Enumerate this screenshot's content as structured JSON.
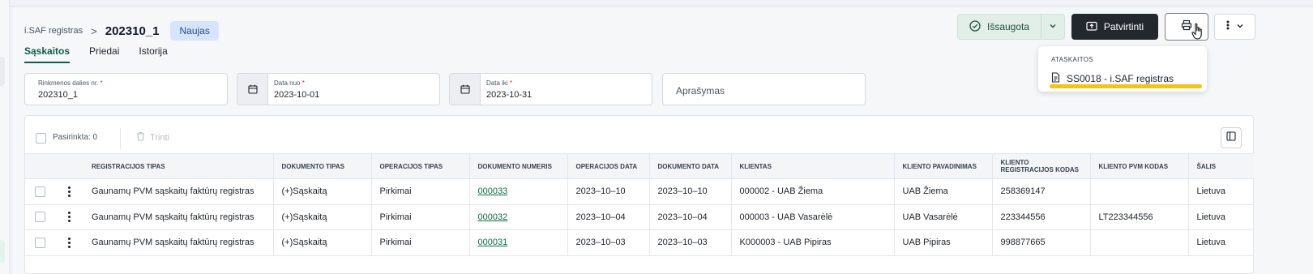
{
  "breadcrumb": {
    "parent": "i.SAF registras",
    "separator": ">",
    "title": "202310_1",
    "status_badge": "Naujas"
  },
  "tabs": [
    {
      "label": "Sąskaitos",
      "active": true
    },
    {
      "label": "Priedai",
      "active": false
    },
    {
      "label": "Istorija",
      "active": false
    }
  ],
  "actions": {
    "saved_label": "Išsaugota",
    "confirm_label": "Patvirtinti",
    "print_icon": "printer-icon",
    "more_icon": "kebab-icon"
  },
  "print_menu": {
    "header": "ATASKAITOS",
    "items": [
      {
        "label": "SS0018 - i.SAF registras",
        "icon": "document-icon"
      }
    ]
  },
  "form": {
    "part_no": {
      "label": "Rinkmenos dalies nr.",
      "required_mark": "*",
      "value": "202310_1"
    },
    "date_from": {
      "label": "Data nuo",
      "required_mark": "*",
      "value": "2023-10-01"
    },
    "date_to": {
      "label": "Data iki",
      "required_mark": "*",
      "value": "2023-10-31"
    },
    "description": {
      "placeholder": "Aprašymas"
    }
  },
  "table_toolbar": {
    "selected_label": "Pasirinkta: 0",
    "delete_label": "Trinti"
  },
  "table": {
    "columns": [
      "Registracijos tipas",
      "Dokumento tipas",
      "Operacijos tipas",
      "Dokumento numeris",
      "Operacijos data",
      "Dokumento data",
      "Klientas",
      "Kliento pavadinimas",
      "Kliento registracijos kodas",
      "Kliento PVM kodas",
      "Šalis"
    ],
    "rows": [
      [
        "Gaunamų PVM sąskaitų faktūrų registras",
        "(+)Sąskaitą",
        "Pirkimai",
        "000033",
        "2023–10–10",
        "2023–10–10",
        "000002 - UAB Žiema",
        "UAB Žiema",
        "258369147",
        "",
        "Lietuva"
      ],
      [
        "Gaunamų PVM sąskaitų faktūrų registras",
        "(+)Sąskaitą",
        "Pirkimai",
        "000032",
        "2023–10–04",
        "2023–10–04",
        "000003 - UAB Vasarėlė",
        "UAB Vasarėlė",
        "223344556",
        "LT223344556",
        "Lietuva"
      ],
      [
        "Gaunamų PVM sąskaitų faktūrų registras",
        "(+)Sąskaitą",
        "Pirkimai",
        "000031",
        "2023–10–03",
        "2023–10–03",
        "K000003 - UAB Pipiras",
        "UAB Pipiras",
        "998877665",
        "",
        "Lietuva"
      ]
    ]
  },
  "colors": {
    "accent_green": "#0f5d47",
    "link_green": "#0f6b45",
    "dark_button": "#23272e",
    "highlight_yellow": "#f0c419",
    "badge_bg": "#d6e4ff"
  }
}
